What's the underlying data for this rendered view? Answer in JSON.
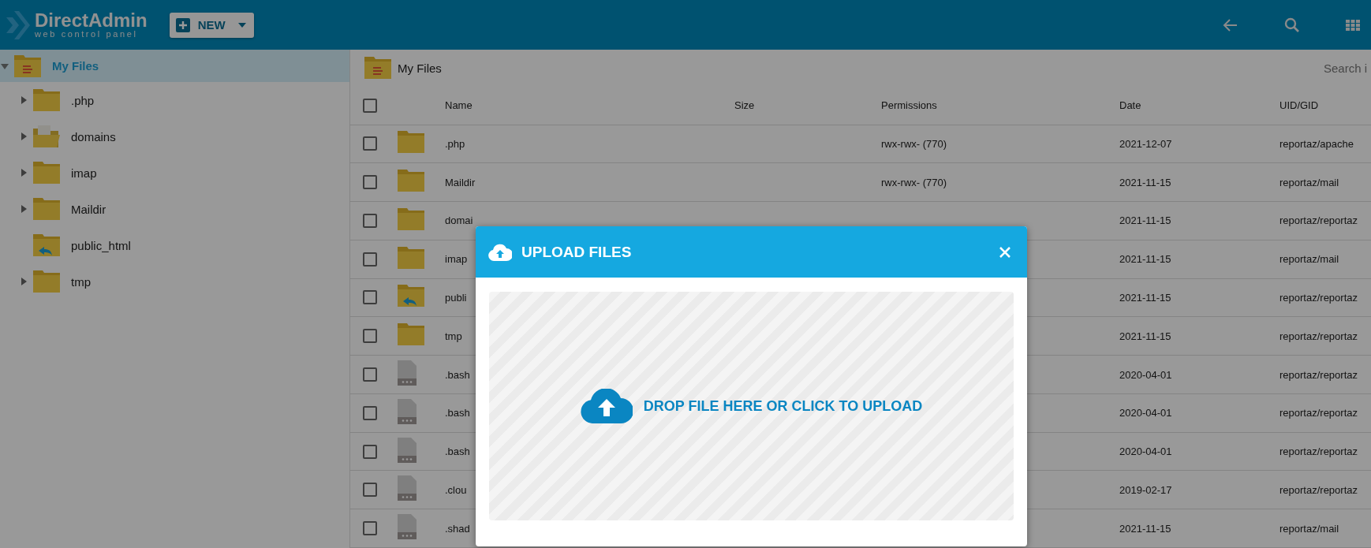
{
  "header": {
    "logo": {
      "name": "DirectAdmin",
      "tagline": "web control panel"
    },
    "new_button": {
      "label": "NEW"
    }
  },
  "sidebar": {
    "tree": [
      {
        "label": "My Files",
        "kind": "home",
        "selected": true,
        "expandable": true,
        "expanded": true,
        "children": [
          {
            "label": ".php",
            "kind": "folder",
            "selected": false,
            "expandable": true,
            "expanded": false
          },
          {
            "label": "domains",
            "kind": "open",
            "selected": false,
            "expandable": true,
            "expanded": false
          },
          {
            "label": "imap",
            "kind": "folder",
            "selected": false,
            "expandable": true,
            "expanded": false
          },
          {
            "label": "Maildir",
            "kind": "folder",
            "selected": false,
            "expandable": true,
            "expanded": false
          },
          {
            "label": "public_html",
            "kind": "link",
            "selected": false,
            "expandable": false,
            "expanded": false
          },
          {
            "label": "tmp",
            "kind": "folder",
            "selected": false,
            "expandable": true,
            "expanded": false
          }
        ]
      }
    ]
  },
  "breadcrumb": {
    "label": "My Files"
  },
  "search": {
    "placeholder": "Search i"
  },
  "table": {
    "select_all": {
      "checked": false
    },
    "columns": [
      "Name",
      "Size",
      "Permissions",
      "Date",
      "UID/GID"
    ],
    "rows": [
      {
        "kind": "folder",
        "checked": false,
        "name": ".php",
        "permissions": "rwx-rwx- (770)",
        "date": "2021-12-07",
        "owner": "reportaz/apache"
      },
      {
        "kind": "folder",
        "checked": false,
        "name": "Maildir",
        "permissions": "rwx-rwx- (770)",
        "date": "2021-11-15",
        "owner": "reportaz/mail"
      },
      {
        "kind": "folder",
        "checked": false,
        "name": "domai",
        "date": "2021-11-15",
        "owner": "reportaz/reportaz"
      },
      {
        "kind": "folder",
        "checked": false,
        "name": "imap",
        "date": "2021-11-15",
        "owner": "reportaz/mail"
      },
      {
        "kind": "link",
        "checked": false,
        "name": "publi",
        "date": "2021-11-15",
        "owner": "reportaz/reportaz"
      },
      {
        "kind": "folder",
        "checked": false,
        "name": "tmp",
        "date": "2021-11-15",
        "owner": "reportaz/reportaz"
      },
      {
        "kind": "file",
        "checked": false,
        "name": ".bash",
        "date": "2020-04-01",
        "owner": "reportaz/reportaz"
      },
      {
        "kind": "file",
        "checked": false,
        "name": ".bash",
        "date": "2020-04-01",
        "owner": "reportaz/reportaz"
      },
      {
        "kind": "file",
        "checked": false,
        "name": ".bash",
        "date": "2020-04-01",
        "owner": "reportaz/reportaz"
      },
      {
        "kind": "file",
        "checked": false,
        "name": ".clou",
        "date": "2019-02-17",
        "owner": "reportaz/reportaz"
      },
      {
        "kind": "file",
        "checked": false,
        "name": ".shad",
        "date": "2021-11-15",
        "owner": "reportaz/mail"
      }
    ]
  },
  "modal": {
    "title": "UPLOAD FILES",
    "dropzone": "DROP FILE HERE OR CLICK TO UPLOAD"
  }
}
